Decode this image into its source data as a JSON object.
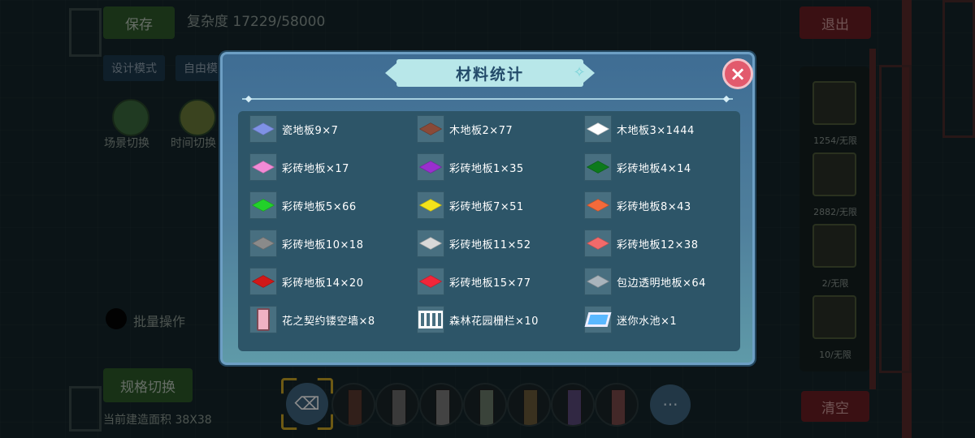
{
  "background": {
    "save_label": "保存",
    "complexity_label": "复杂度 17229/58000",
    "design_mode_label": "设计模式",
    "free_mode_label": "自由模",
    "scene_switch_label": "场景切换",
    "time_switch_label": "时间切换",
    "batch_label": "批量操作",
    "spec_switch_label": "规格切换",
    "area_label": "当前建造面积 38X38",
    "exit_label": "退出",
    "clear_label": "清空",
    "inventory_counts": [
      "1254/无限",
      "2882/无限",
      "2/无限",
      "10/无限"
    ],
    "more_label": "···"
  },
  "modal": {
    "title": "材料统计",
    "close_icon": "×"
  },
  "materials": [
    {
      "label": "瓷地板9×7",
      "color": "#7f92e6",
      "icon": "tile"
    },
    {
      "label": "木地板2×77",
      "color": "#8a4a38",
      "icon": "tile"
    },
    {
      "label": "木地板3×1444",
      "color": "#ffffff",
      "icon": "tile"
    },
    {
      "label": "彩砖地板×17",
      "color": "#f28ad6",
      "icon": "tile"
    },
    {
      "label": "彩砖地板1×35",
      "color": "#9a2fce",
      "icon": "tile"
    },
    {
      "label": "彩砖地板4×14",
      "color": "#0d7a1c",
      "icon": "tile"
    },
    {
      "label": "彩砖地板5×66",
      "color": "#22d12a",
      "icon": "tile"
    },
    {
      "label": "彩砖地板7×51",
      "color": "#f4e21b",
      "icon": "tile"
    },
    {
      "label": "彩砖地板8×43",
      "color": "#f36a3a",
      "icon": "tile"
    },
    {
      "label": "彩砖地板10×18",
      "color": "#8a8a8a",
      "icon": "tile"
    },
    {
      "label": "彩砖地板11×52",
      "color": "#d8d8d8",
      "icon": "tile"
    },
    {
      "label": "彩砖地板12×38",
      "color": "#f26a6a",
      "icon": "tile"
    },
    {
      "label": "彩砖地板14×20",
      "color": "#d11818",
      "icon": "tile"
    },
    {
      "label": "彩砖地板15×77",
      "color": "#f2263a",
      "icon": "tile"
    },
    {
      "label": "包边透明地板×64",
      "color": "#a9b4bc",
      "icon": "tile"
    },
    {
      "label": "花之契约镂空墙×8",
      "color": "#f0b2c4",
      "icon": "door"
    },
    {
      "label": "森林花园栅栏×10",
      "color": "#ffffff",
      "icon": "fence"
    },
    {
      "label": "迷你水池×1",
      "color": "#5ab8ff",
      "icon": "pool"
    }
  ]
}
